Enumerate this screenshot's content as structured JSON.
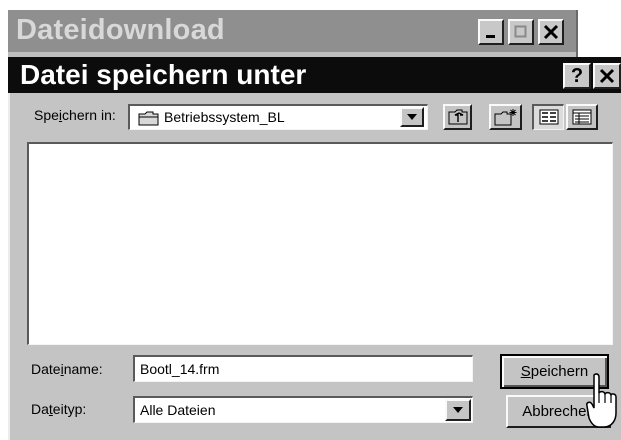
{
  "background_window": {
    "title": "Dateidownload",
    "minimize_glyph": "_",
    "close_glyph": "×"
  },
  "dialog": {
    "title": "Datei speichern unter",
    "help_glyph": "?",
    "close_glyph": "×",
    "save_in": {
      "label_pre": "Spe",
      "label_accel": "i",
      "label_post": "chern in:",
      "value": "Betriebssystem_BL"
    },
    "filename": {
      "label_pre": "Date",
      "label_accel": "i",
      "label_post": "name:",
      "value": "Bootl_14.frm"
    },
    "filetype": {
      "label_pre": "Da",
      "label_accel": "t",
      "label_post": "eityp:",
      "value": "Alle Dateien"
    },
    "buttons": {
      "save_accel": "S",
      "save_rest": "peichern",
      "cancel": "Abbrechen"
    },
    "icons": [
      "folder-icon",
      "up-one-level-icon",
      "new-folder-icon",
      "list-view-icon",
      "details-view-icon",
      "dropdown-arrow-icon"
    ]
  }
}
